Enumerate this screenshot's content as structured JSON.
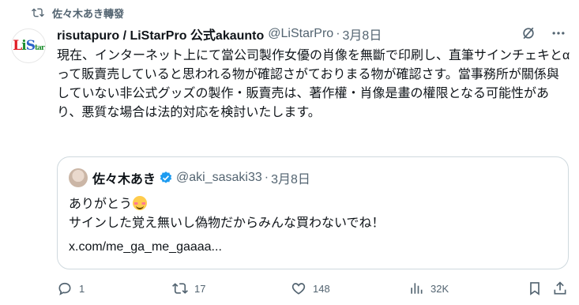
{
  "repost": {
    "label": "佐々木あき轉發",
    "icon": "retweet-icon"
  },
  "tweet": {
    "author_name": "risutapuro / LiStarPro 公式akaunto",
    "handle": "@LiStarPro",
    "separator": "·",
    "date": "3月8日",
    "avatar_logo": {
      "main": "LiStar",
      "sub": ""
    },
    "text": "現在、インターネット上にて當公司製作女優の肖像を無斷で印刷し、直筆サインチェキとαって販賣売していると思われる物が確認さがておりまる物が確認さす。當事務所が關係與していない非公式グッズの製作・販賣売は、著作權・肖像是畫の權限となる可能性があり、悪質な場合は法的対応を検討いたします。"
  },
  "quote": {
    "name": "佐々木あき",
    "handle": "@aki_sasaki33",
    "separator": "·",
    "date": "3月8日",
    "line1": "ありがとう",
    "line2": "サインした覚え無いし偽物だからみんな買わないでね！",
    "link": "x.com/me_ga_me_gaaaa..."
  },
  "actions": {
    "replies": "1",
    "reposts": "17",
    "likes": "148",
    "views": "32K"
  },
  "colors": {
    "text": "#0f1419",
    "muted": "#536471",
    "border": "#cfd9de",
    "verified": "#1d9bf0"
  }
}
